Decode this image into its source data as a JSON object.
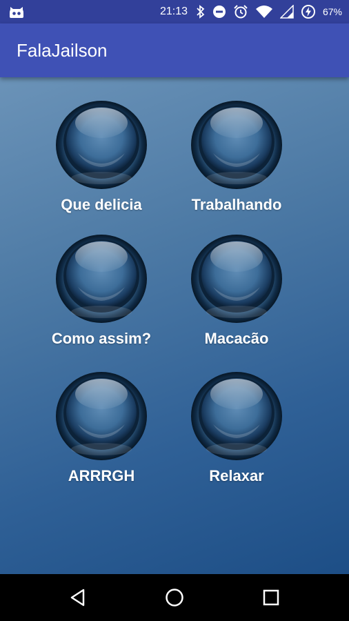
{
  "status_bar": {
    "time": "21:13",
    "battery_percent": "67%",
    "icons": [
      "android-notification-icon",
      "bluetooth-icon",
      "do-not-disturb-icon",
      "alarm-icon",
      "wifi-icon",
      "signal-icon",
      "battery-charging-icon"
    ]
  },
  "app_bar": {
    "title": "FalaJailson"
  },
  "sounds": [
    {
      "label": "Que delicia"
    },
    {
      "label": "Trabalhando"
    },
    {
      "label": "Como assim?"
    },
    {
      "label": "Macacão"
    },
    {
      "label": "ARRRGH"
    },
    {
      "label": "Relaxar"
    }
  ],
  "nav_bar": {
    "buttons": [
      "back-icon",
      "home-icon",
      "recents-icon"
    ]
  },
  "colors": {
    "status_bar": "#32409a",
    "app_bar": "#3f51b5",
    "background_top": "#6b93b8",
    "background_bottom": "#1d4e86",
    "label_text": "#ffffff"
  }
}
